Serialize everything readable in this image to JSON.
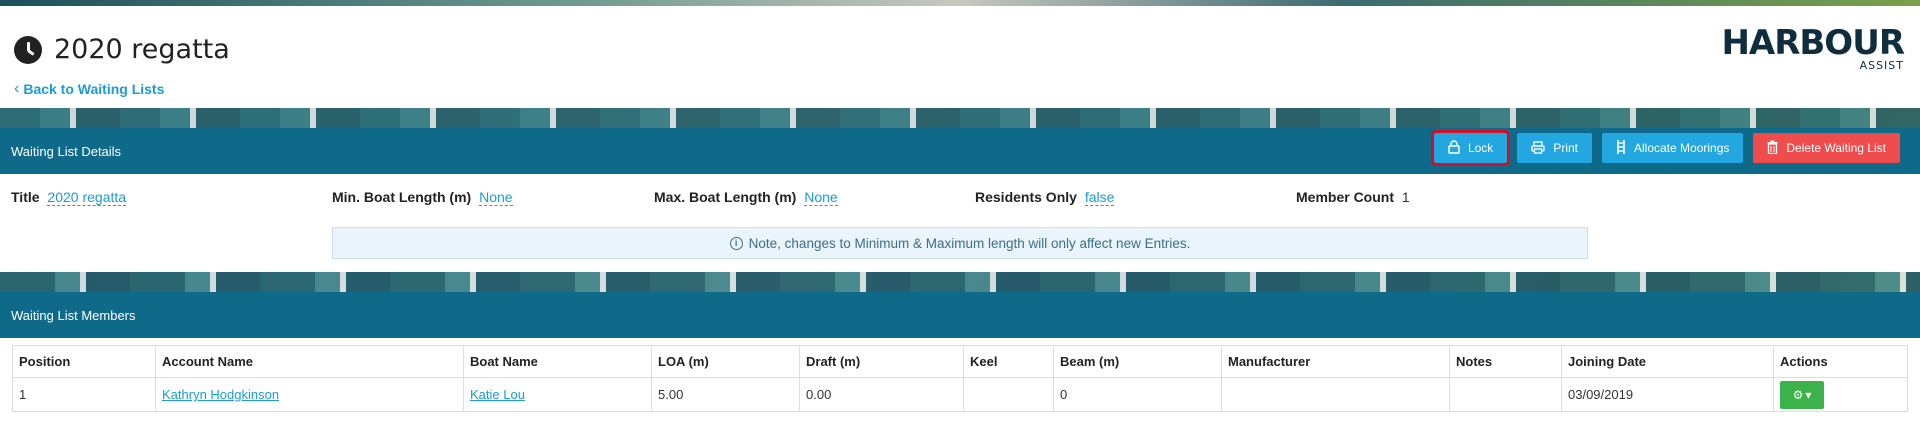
{
  "page": {
    "title": "2020 regatta",
    "back_label": "Back to Waiting Lists"
  },
  "logo": {
    "main": "HARBOUR",
    "sub": "ASSIST"
  },
  "details_panel": {
    "heading": "Waiting List Details",
    "buttons": {
      "lock": "Lock",
      "print": "Print",
      "allocate": "Allocate Moorings",
      "delete": "Delete Waiting List"
    },
    "fields": {
      "title_label": "Title",
      "title_value": "2020 regatta",
      "min_label": "Min. Boat Length (m)",
      "min_value": "None",
      "max_label": "Max. Boat Length (m)",
      "max_value": "None",
      "residents_label": "Residents Only",
      "residents_value": "false",
      "member_count_label": "Member Count",
      "member_count_value": "1"
    },
    "note": "Note, changes to Minimum & Maximum length will only affect new Entries."
  },
  "members_panel": {
    "heading": "Waiting List Members",
    "columns": [
      "Position",
      "Account Name",
      "Boat Name",
      "LOA (m)",
      "Draft (m)",
      "Keel",
      "Beam (m)",
      "Manufacturer",
      "Notes",
      "Joining Date",
      "Actions"
    ],
    "rows": [
      {
        "position": "1",
        "account_name": "Kathryn Hodgkinson",
        "boat_name": "Katie Lou",
        "loa": "5.00",
        "draft": "0.00",
        "keel": "",
        "beam": "0",
        "manufacturer": "",
        "notes": "",
        "joining_date": "03/09/2019"
      }
    ]
  },
  "icons": {
    "clock": "clock-icon",
    "lock": "lock-icon",
    "print": "printer-icon",
    "allocate": "ladder-icon",
    "delete": "trash-icon",
    "info": "info-icon",
    "gear": "gear-icon"
  },
  "colors": {
    "panel_header": "#0f6a8a",
    "primary_button": "#22a7e0",
    "danger_button": "#ef4d4d",
    "success_button": "#3cb34a",
    "link": "#1d9bd6",
    "highlight_outline": "#d0102a"
  }
}
